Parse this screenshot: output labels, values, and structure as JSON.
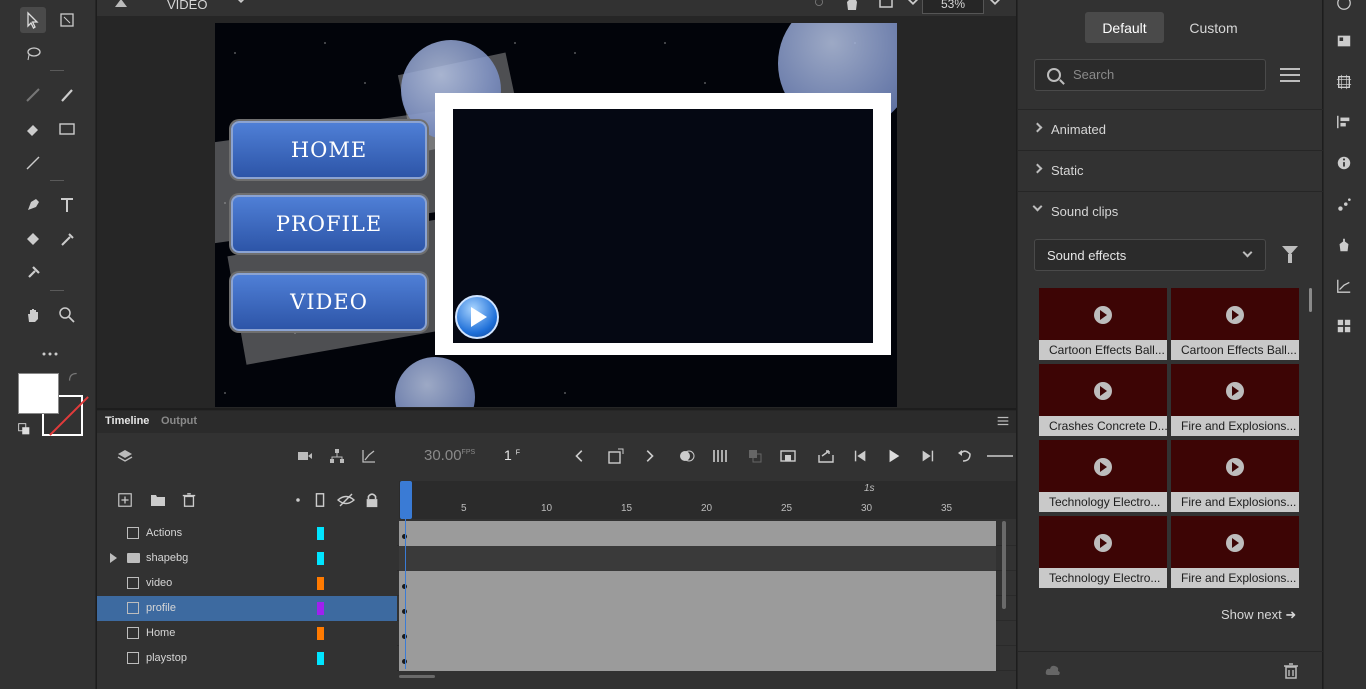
{
  "stage_toolbar": {
    "scene_name": "VIDEO",
    "zoom": "53%"
  },
  "stage": {
    "buttons": [
      "HOME",
      "PROFILE",
      "VIDEO"
    ]
  },
  "timeline": {
    "tabs": [
      "Timeline",
      "Output"
    ],
    "fps": "30.00",
    "fps_unit": "FPS",
    "frame": "1",
    "frame_unit": "F",
    "ruler_marks": [
      "5",
      "10",
      "15",
      "20",
      "25",
      "30",
      "35"
    ],
    "ruler_seconds": "1s",
    "layers": [
      {
        "name": "Actions",
        "color": "#00e5ff",
        "folder": false,
        "selected": false
      },
      {
        "name": "shapebg",
        "color": "#00e5ff",
        "folder": true,
        "selected": false
      },
      {
        "name": "video",
        "color": "#ff7a00",
        "folder": false,
        "selected": false
      },
      {
        "name": "profile",
        "color": "#a020f0",
        "folder": false,
        "selected": true
      },
      {
        "name": "Home",
        "color": "#ff7a00",
        "folder": false,
        "selected": false
      },
      {
        "name": "playstop",
        "color": "#00e5ff",
        "folder": false,
        "selected": false
      }
    ]
  },
  "panel": {
    "tabs": [
      "Default",
      "Custom"
    ],
    "search_placeholder": "Search",
    "sections": [
      "Animated",
      "Static",
      "Sound clips"
    ],
    "dropdown_value": "Sound effects",
    "clips": [
      "Cartoon Effects Ball...",
      "Cartoon Effects Ball...",
      "Crashes Concrete D...",
      "Fire and Explosions...",
      "Technology Electro...",
      "Fire and Explosions...",
      "Technology Electro...",
      "Fire and Explosions..."
    ],
    "show_next": "Show next ➜"
  }
}
